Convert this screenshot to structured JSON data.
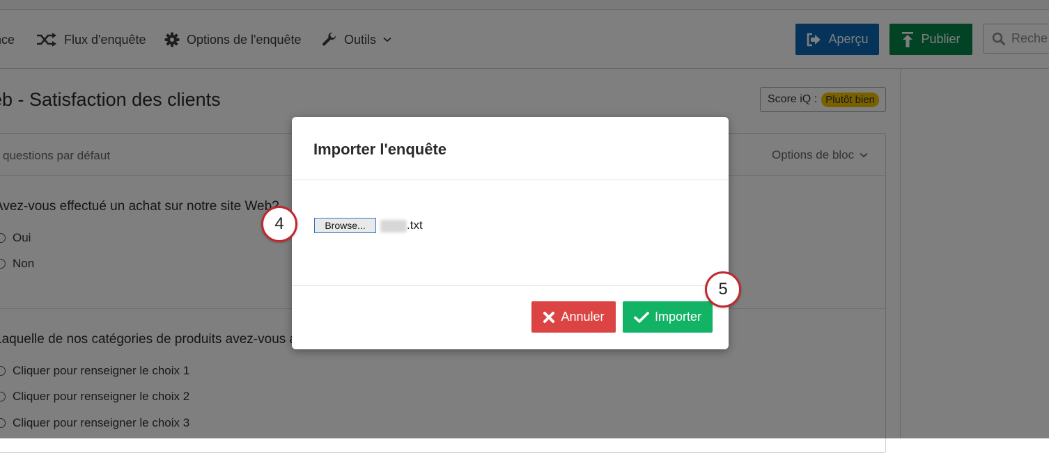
{
  "toolbar": {
    "items": [
      {
        "label": "nce"
      },
      {
        "label": "Flux d'enquête"
      },
      {
        "label": "Options de l'enquête"
      },
      {
        "label": "Outils"
      }
    ],
    "preview_label": "Aperçu",
    "publish_label": "Publier",
    "search_placeholder": "Reche"
  },
  "survey": {
    "title": "eb - Satisfaction des clients",
    "iq_label": "Score iQ :",
    "iq_badge": "Plutôt bien",
    "block_name": "questions par défaut",
    "block_options": "Options de bloc",
    "questions": [
      {
        "text": "Avez-vous effectué un achat sur notre site Web?",
        "choices": [
          "Oui",
          "Non"
        ]
      },
      {
        "text": "Laquelle de nos catégories de produits avez-vous a",
        "choices": [
          "Cliquer pour renseigner le choix 1",
          "Cliquer pour renseigner le choix 2",
          "Cliquer pour renseigner le choix 3"
        ]
      }
    ]
  },
  "modal": {
    "title": "Importer l'enquête",
    "browse_label": "Browse...",
    "file_name": ".txt",
    "cancel_label": "Annuler",
    "import_label": "Importer"
  },
  "steps": [
    "4",
    "5"
  ],
  "colors": {
    "preview": "#0b67b4",
    "publish": "#07864a",
    "cancel": "#dc4444",
    "import": "#13b365",
    "step_ring": "#c1272d",
    "iq_badge": "#f2c200"
  }
}
